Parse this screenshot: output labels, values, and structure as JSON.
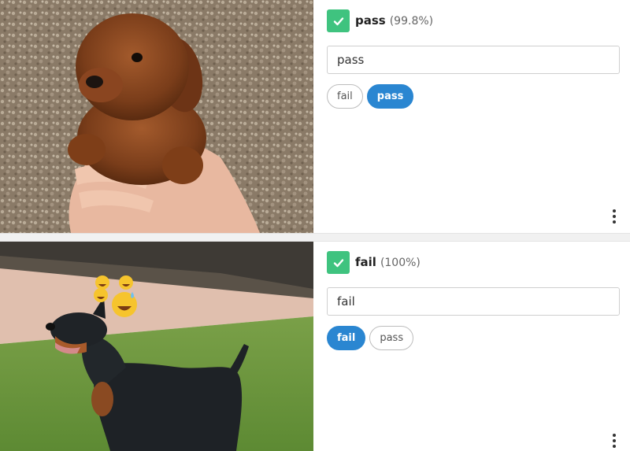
{
  "items": [
    {
      "label": "pass",
      "confidence": "(99.8%)",
      "input_value": "pass",
      "options": [
        {
          "label": "fail",
          "selected": false
        },
        {
          "label": "pass",
          "selected": true
        }
      ],
      "image_subject": "puppy held in hands"
    },
    {
      "label": "fail",
      "confidence": "(100%)",
      "input_value": "fail",
      "options": [
        {
          "label": "fail",
          "selected": true
        },
        {
          "label": "pass",
          "selected": false
        }
      ],
      "image_subject": "doberman with emoji overlay"
    }
  ],
  "colors": {
    "check_green": "#3fc37f",
    "pill_selected": "#2a86d1"
  },
  "icons": {
    "check": "checkmark-icon",
    "menu": "more-vertical-icon",
    "emoji": "grinning-sweat-emoji"
  }
}
